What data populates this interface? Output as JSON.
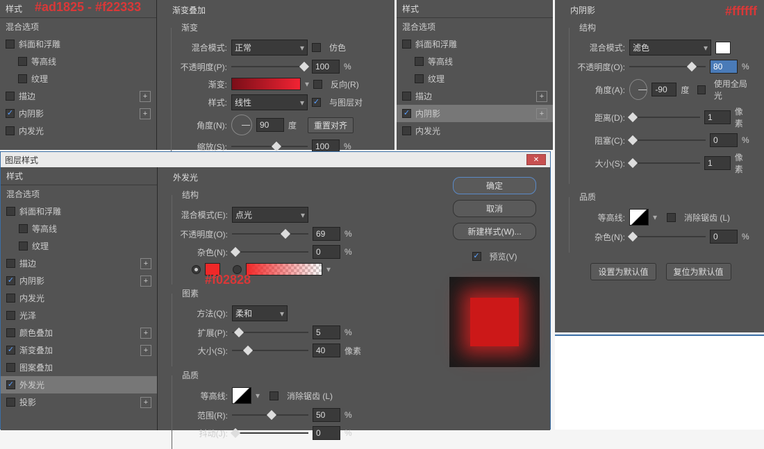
{
  "annotations": {
    "gradient": "#ad1825 - #f22333",
    "white": "#ffffff",
    "red_color": "#f02828"
  },
  "panel1": {
    "styles_header": "样式",
    "blend_options": "混合选项",
    "items": {
      "bevel": "斜面和浮雕",
      "contour": "等高线",
      "texture": "纹理",
      "stroke": "描边",
      "inner_shadow": "内阴影",
      "outer_glow": "内发光"
    },
    "gradient_overlay_section": "渐变叠加",
    "gradient_group": "渐变",
    "blend_mode": "混合模式:",
    "blend_mode_val": "正常",
    "dither": "仿色",
    "opacity": "不透明度(P):",
    "opacity_val": "100",
    "gradient_lbl": "渐变:",
    "reverse": "反向(R)",
    "style_lbl": "样式:",
    "style_val": "线性",
    "align_with_layer": "与图层对",
    "angle": "角度(N):",
    "angle_val": "90",
    "degree": "度",
    "reset_align": "重置对齐",
    "scale": "缩放(S):",
    "scale_val": "100"
  },
  "panel2": {
    "styles_header": "样式",
    "blend_options": "混合选项",
    "items": {
      "bevel": "斜面和浮雕",
      "contour": "等高线",
      "texture": "纹理",
      "stroke": "描边",
      "inner_shadow": "内阴影",
      "outer_glow": "内发光"
    }
  },
  "panel3": {
    "inner_shadow_section": "内阴影",
    "structure": "结构",
    "blend_mode": "混合模式:",
    "blend_mode_val": "滤色",
    "opacity": "不透明度(O):",
    "opacity_val": "80",
    "angle": "角度(A):",
    "angle_val": "-90",
    "degree": "度",
    "use_global": "使用全局光",
    "distance": "距离(D):",
    "distance_val": "1",
    "px": "像素",
    "choke": "阻塞(C):",
    "choke_val": "0",
    "size": "大小(S):",
    "size_val": "1",
    "quality": "品质",
    "contour": "等高线:",
    "anti_alias": "消除锯齿 (L)",
    "noise": "杂色(N):",
    "noise_val": "0",
    "set_default": "设置为默认值",
    "reset_default": "复位为默认值"
  },
  "dialog": {
    "title": "图层样式",
    "styles_header": "样式",
    "blend_options": "混合选项",
    "items": {
      "bevel": "斜面和浮雕",
      "contour": "等高线",
      "texture": "纹理",
      "stroke": "描边",
      "inner_shadow": "内阴影",
      "inner_glow": "内发光",
      "sheen": "光泽",
      "color_overlay": "颜色叠加",
      "gradient_overlay": "渐变叠加",
      "pattern_overlay": "图案叠加",
      "outer_glow": "外发光",
      "drop_shadow": "投影"
    },
    "outer_glow_section": "外发光",
    "structure": "结构",
    "blend_mode": "混合模式(E):",
    "blend_mode_val": "点光",
    "opacity": "不透明度(O):",
    "opacity_val": "69",
    "noise": "杂色(N):",
    "noise_val": "0",
    "elements": "图素",
    "technique": "方法(Q):",
    "technique_val": "柔和",
    "spread": "扩展(P):",
    "spread_val": "5",
    "size": "大小(S):",
    "size_val": "40",
    "px": "像素",
    "quality": "品质",
    "contour": "等高线:",
    "anti_alias": "消除锯齿 (L)",
    "range": "范围(R):",
    "range_val": "50",
    "jitter": "抖动(J):",
    "jitter_val": "0",
    "ok": "确定",
    "cancel": "取消",
    "new_style": "新建样式(W)...",
    "preview": "预览(V)"
  }
}
